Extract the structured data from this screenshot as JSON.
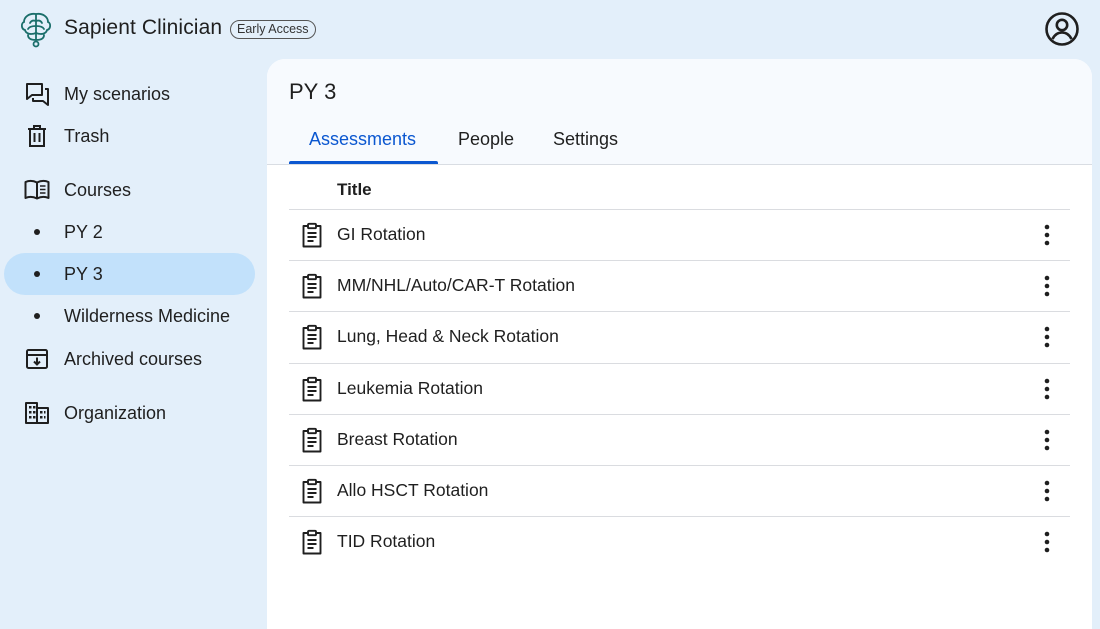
{
  "app": {
    "title": "Sapient Clinician",
    "badge": "Early Access"
  },
  "sidebar": {
    "items": [
      {
        "label": "My scenarios",
        "icon": "forum-icon"
      },
      {
        "label": "Trash",
        "icon": "trash-icon"
      },
      {
        "label": "Courses",
        "icon": "book-icon"
      },
      {
        "label": "PY 2",
        "icon": "bullet"
      },
      {
        "label": "PY 3",
        "icon": "bullet",
        "active": true
      },
      {
        "label": "Wilderness Medicine",
        "icon": "bullet"
      },
      {
        "label": "Archived courses",
        "icon": "archive-icon"
      },
      {
        "label": "Organization",
        "icon": "building-icon"
      }
    ]
  },
  "main": {
    "title": "PY 3",
    "tabs": [
      {
        "label": "Assessments",
        "active": true
      },
      {
        "label": "People"
      },
      {
        "label": "Settings"
      }
    ],
    "table": {
      "header": "Title",
      "rows": [
        "GI Rotation",
        "MM/NHL/Auto/CAR-T Rotation",
        "Lung, Head & Neck Rotation",
        "Leukemia Rotation",
        "Breast Rotation",
        "Allo HSCT Rotation",
        "TID Rotation"
      ]
    }
  },
  "colors": {
    "background": "#e3effa",
    "active_nav": "#c2e1fb",
    "accent": "#0b57d0",
    "logo": "#1a6e6a"
  }
}
